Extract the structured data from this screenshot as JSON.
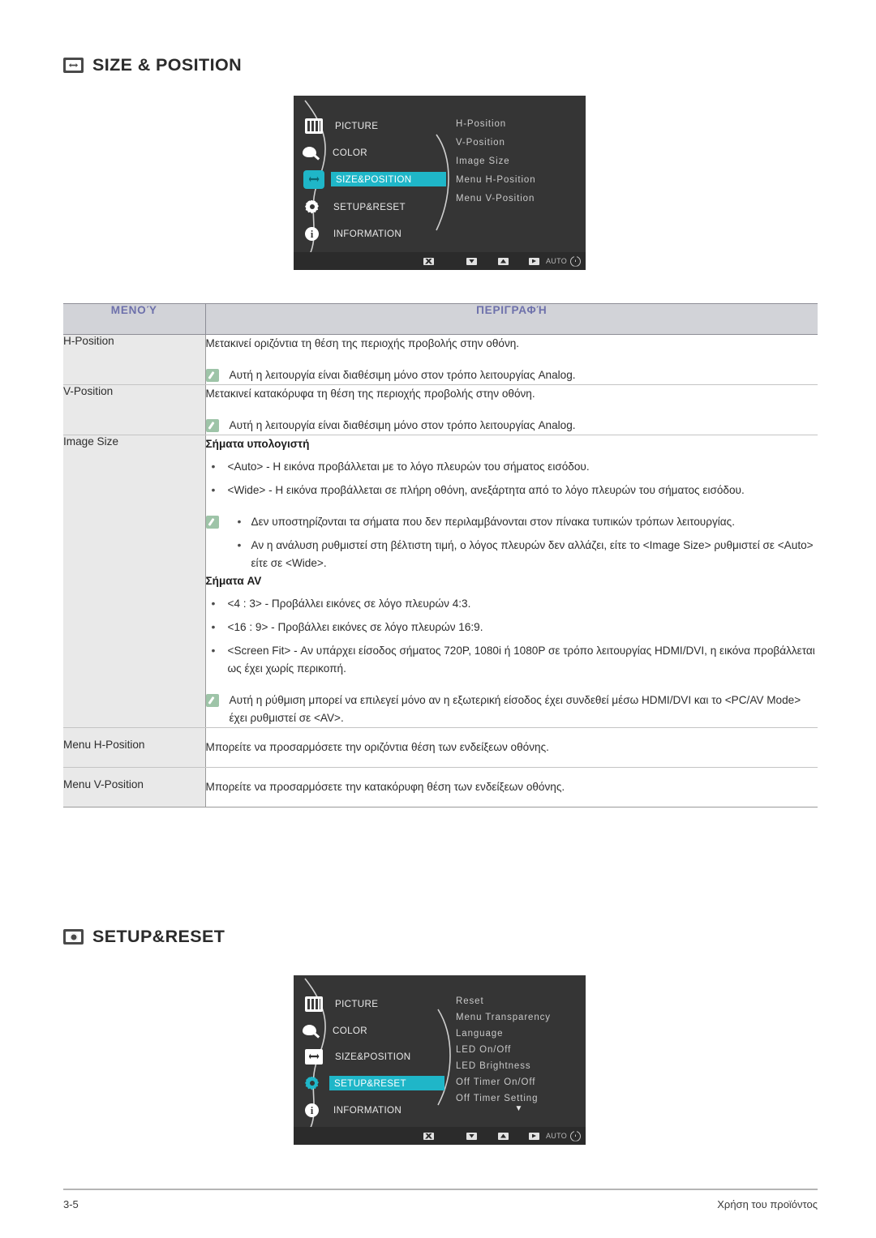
{
  "sections": [
    {
      "id": "size-position",
      "title": "SIZE & POSITION",
      "icon": "size-position-icon"
    },
    {
      "id": "setup-reset",
      "title": "SETUP&RESET",
      "icon": "setup-reset-icon"
    }
  ],
  "osd_top": {
    "left_menu": [
      {
        "label": "PICTURE",
        "icon": "picture-icon",
        "selected": false
      },
      {
        "label": "COLOR",
        "icon": "palette-icon",
        "selected": false
      },
      {
        "label": "SIZE&POSITION",
        "icon": "size-position-icon",
        "selected": true
      },
      {
        "label": "SETUP&RESET",
        "icon": "gear-icon",
        "selected": false
      },
      {
        "label": "INFORMATION",
        "icon": "info-icon",
        "selected": false
      }
    ],
    "right_items": [
      "H-Position",
      "V-Position",
      "Image Size",
      "Menu H-Position",
      "Menu V-Position"
    ],
    "more_arrow": "",
    "buttons": [
      {
        "name": "exit-icon",
        "glyph": "x"
      },
      {
        "name": "down-icon",
        "glyph": "dn"
      },
      {
        "name": "up-icon",
        "glyph": "up"
      },
      {
        "name": "enter-icon",
        "glyph": "pl"
      },
      {
        "name": "auto-button",
        "glyph": "text",
        "label": "AUTO"
      },
      {
        "name": "power-icon",
        "glyph": "pwr"
      }
    ],
    "highlight_color": "#1fb6c8",
    "background_color": "#353535"
  },
  "osd_bottom": {
    "left_menu": [
      {
        "label": "PICTURE",
        "icon": "picture-icon",
        "selected": false
      },
      {
        "label": "COLOR",
        "icon": "palette-icon",
        "selected": false
      },
      {
        "label": "SIZE&POSITION",
        "icon": "size-position-icon",
        "selected": false
      },
      {
        "label": "SETUP&RESET",
        "icon": "gear-icon",
        "selected": true
      },
      {
        "label": "INFORMATION",
        "icon": "info-icon",
        "selected": false
      }
    ],
    "right_items": [
      "Reset",
      "Menu Transparency",
      "Language",
      "LED On/Off",
      "LED Brightness",
      "Off Timer On/Off",
      "Off Timer Setting"
    ],
    "more_arrow": "▼",
    "buttons": [
      {
        "name": "exit-icon",
        "glyph": "x"
      },
      {
        "name": "down-icon",
        "glyph": "dn"
      },
      {
        "name": "up-icon",
        "glyph": "up"
      },
      {
        "name": "enter-icon",
        "glyph": "pl"
      },
      {
        "name": "auto-button",
        "glyph": "text",
        "label": "AUTO"
      },
      {
        "name": "power-icon",
        "glyph": "pwr"
      }
    ],
    "highlight_color": "#1fb6c8",
    "background_color": "#353535"
  },
  "table": {
    "headers": {
      "menu": "ΜΕΝΟΎ",
      "description": "ΠΕΡΙΓΡΑΦΉ"
    },
    "header_text_color": "#6e71ab",
    "header_bg_color": "#d2d3d8",
    "rows": {
      "h_position": {
        "menu": "H-Position",
        "desc": "Μετακινεί οριζόντια τη θέση της περιοχής προβολής στην οθόνη.",
        "note": "Αυτή η λειτουργία είναι διαθέσιμη μόνο στον τρόπο λειτουργίας Analog."
      },
      "v_position": {
        "menu": "V-Position",
        "desc": "Μετακινεί κατακόρυφα τη θέση της περιοχής προβολής στην οθόνη.",
        "note": "Αυτή η λειτουργία είναι διαθέσιμη μόνο στον τρόπο λειτουργίας Analog."
      },
      "image_size": {
        "menu": "Image Size",
        "pc_title": "Σήματα υπολογιστή",
        "pc_bullets": [
          "<Auto> - Η εικόνα προβάλλεται με το λόγο πλευρών του σήματος εισόδου.",
          "<Wide> - Η εικόνα προβάλλεται σε πλήρη οθόνη, ανεξάρτητα από το λόγο πλευρών του σήματος εισόδου."
        ],
        "pc_note_bullets": [
          "Δεν υποστηρίζονται τα σήματα που δεν περιλαμβάνονται στον πίνακα τυπικών τρόπων λειτουργίας.",
          "Αν η ανάλυση ρυθμιστεί στη βέλτιστη τιμή, ο λόγος πλευρών δεν αλλάζει, είτε το <Image Size> ρυθμιστεί σε <Auto> είτε σε <Wide>."
        ],
        "av_title": "Σήματα AV",
        "av_bullets": [
          "<4 : 3> - Προβάλλει εικόνες σε λόγο πλευρών 4:3.",
          "<16 : 9> - Προβάλλει εικόνες σε λόγο πλευρών 16:9.",
          "<Screen Fit> - Αν υπάρχει είσοδος σήματος 720P, 1080i ή 1080P σε τρόπο λειτουργίας HDMI/DVI, η εικόνα προβάλλεται ως έχει χωρίς περικοπή."
        ],
        "av_note": "Αυτή η ρύθμιση μπορεί να επιλεγεί μόνο αν η εξωτερική είσοδος έχει συνδεθεί μέσω HDMI/DVI και το <PC/AV Mode> έχει ρυθμιστεί σε <AV>."
      },
      "menu_h_position": {
        "menu": "Menu H-Position",
        "desc": "Μπορείτε να προσαρμόσετε την οριζόντια θέση των ενδείξεων οθόνης."
      },
      "menu_v_position": {
        "menu": "Menu V-Position",
        "desc": "Μπορείτε να προσαρμόσετε την κατακόρυφη θέση των ενδείξεων οθόνης."
      }
    }
  },
  "footer": {
    "page_number": "3-5",
    "chapter": "Χρήση του προϊόντος"
  }
}
